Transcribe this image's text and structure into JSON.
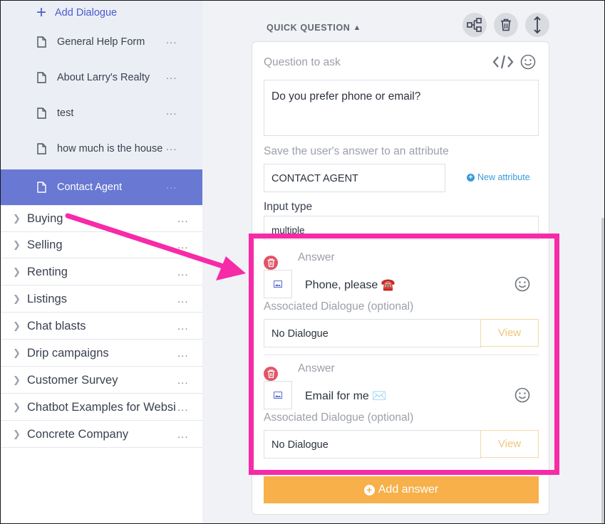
{
  "sidebar": {
    "add_dialogue": "Add Dialogue",
    "dialogues": [
      {
        "label": "General Help Form",
        "menu": "..."
      },
      {
        "label": "About Larry's Realty",
        "menu": "..."
      },
      {
        "label": "test",
        "menu": "..."
      },
      {
        "label": "how much is the house",
        "menu": "..."
      },
      {
        "label": "Contact Agent",
        "menu": "..."
      }
    ],
    "folders": [
      {
        "label": "Buying",
        "menu": "..."
      },
      {
        "label": "Selling",
        "menu": "..."
      },
      {
        "label": "Renting",
        "menu": "..."
      },
      {
        "label": "Listings",
        "menu": "..."
      },
      {
        "label": "Chat blasts",
        "menu": "..."
      },
      {
        "label": "Drip campaigns",
        "menu": "..."
      },
      {
        "label": "Customer Survey",
        "menu": "..."
      },
      {
        "label": "Chatbot Examples for Websites",
        "menu": "..."
      },
      {
        "label": "Concrete Company",
        "menu": "..."
      }
    ],
    "active_color": "#6878d3"
  },
  "quick_question": {
    "heading": "QUICK QUESTION",
    "question_label": "Question to ask",
    "question_value": "Do you prefer phone or email?",
    "attribute_label": "Save the user's answer to an attribute",
    "attribute_value": "CONTACT AGENT",
    "new_attribute": "New attribute",
    "input_type_label": "Input type",
    "input_type_value": "multiple",
    "answers": [
      {
        "label": "Answer",
        "text": "Phone, please",
        "emoji": "☎️",
        "dialogue_label": "Associated Dialogue (optional)",
        "dialogue_value": "No Dialogue",
        "view": "View"
      },
      {
        "label": "Answer",
        "text": "Email for me",
        "emoji": "✉️",
        "dialogue_label": "Associated Dialogue (optional)",
        "dialogue_value": "No Dialogue",
        "view": "View"
      }
    ],
    "add_answer": "Add answer"
  },
  "colors": {
    "accent_button": "#f7b04a",
    "highlight": "#f72aa8",
    "link": "#3a9bd9",
    "delete": "#e05666"
  },
  "icons": {
    "toolbar": [
      "flow-icon",
      "trash-icon",
      "resize-vertical-icon"
    ],
    "question_tools": [
      "code-icon",
      "emoji-icon"
    ]
  }
}
